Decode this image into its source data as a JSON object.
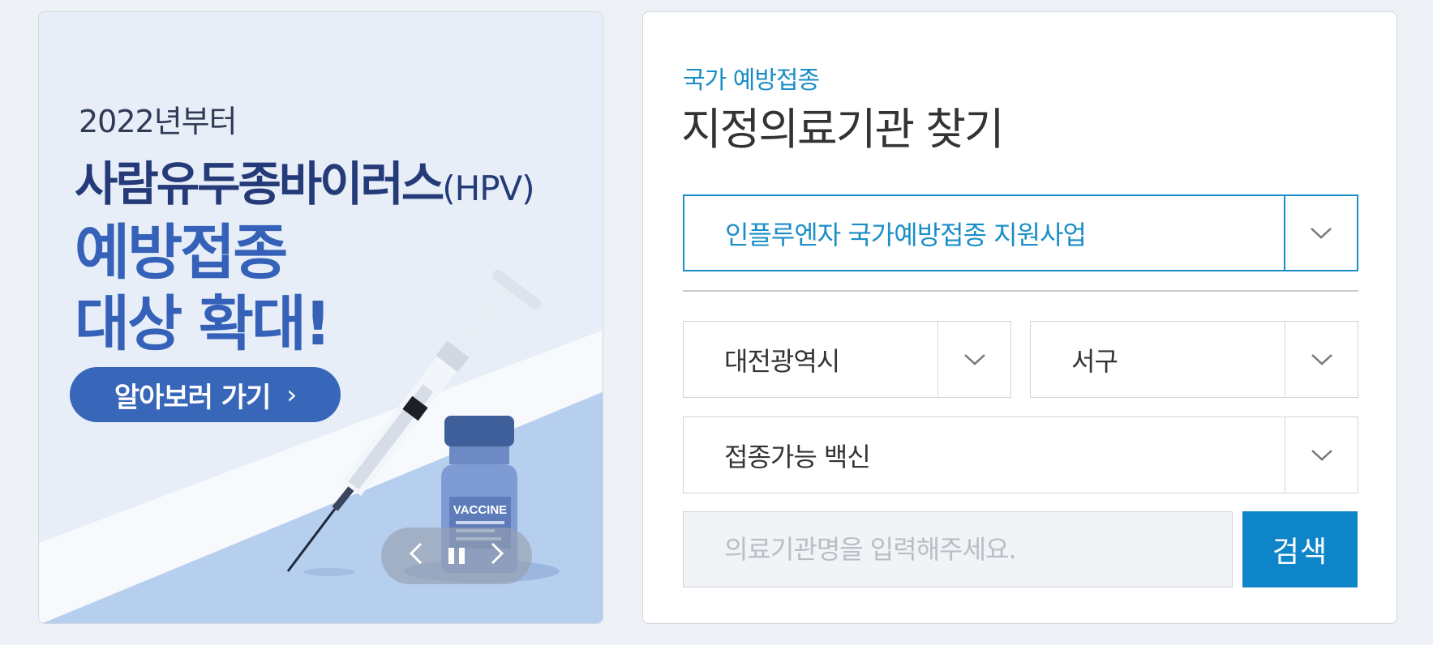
{
  "banner": {
    "year_text": "2022년부터",
    "title_text": "사람유두종바이러스",
    "title_suffix": "(HPV)",
    "line1": "예방접종",
    "line2": "대상 확대!",
    "cta_label": "알아보러 가기",
    "cta_icon": "chevron-right-icon",
    "vial_label": "VACCINE",
    "controls": {
      "prev_icon": "chevron-left-icon",
      "pause_icon": "pause-icon",
      "next_icon": "chevron-right-icon"
    }
  },
  "finder": {
    "subtitle": "국가 예방접종",
    "title": "지정의료기관 찾기",
    "program_select": {
      "value": "인플루엔자 국가예방접종 지원사업"
    },
    "city_select": {
      "value": "대전광역시"
    },
    "district_select": {
      "value": "서구"
    },
    "vaccine_select": {
      "value": "접종가능 백신"
    },
    "search": {
      "placeholder": "의료기관명을 입력해주세요.",
      "button_label": "검색"
    }
  },
  "colors": {
    "accent": "#1a8ec7",
    "button": "#0f85c9",
    "banner_navy": "#253a78",
    "banner_blue": "#3562b8"
  }
}
